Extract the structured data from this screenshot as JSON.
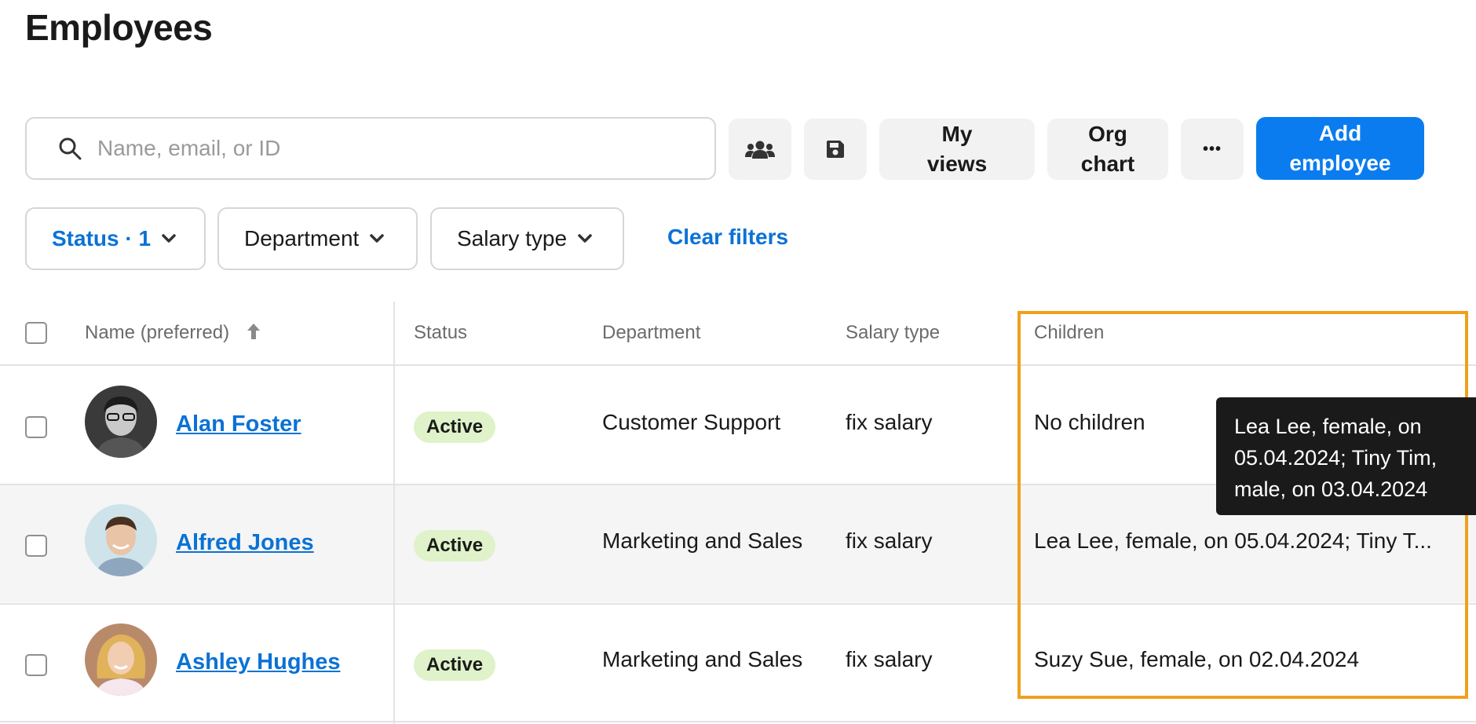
{
  "page": {
    "title": "Employees"
  },
  "search": {
    "placeholder": "Name, email, or ID",
    "icon": "search-icon"
  },
  "toolbar": {
    "groups_icon": "users-icon",
    "save_icon": "floppy-disk-icon",
    "my_views_line1": "My",
    "my_views_line2": "views",
    "org_chart_line1": "Org",
    "org_chart_line2": "chart",
    "more_label": "•••",
    "add_employee_line1": "Add",
    "add_employee_line2": "employee"
  },
  "filters": [
    {
      "label": "Status · 1",
      "active": true
    },
    {
      "label": "Department",
      "active": false
    },
    {
      "label": "Salary type",
      "active": false
    }
  ],
  "clear_filters": "Clear filters",
  "table": {
    "columns": [
      "Name (preferred)",
      "Status",
      "Department",
      "Salary type",
      "Children"
    ],
    "sort_indicator": "arrow-up-icon",
    "rows": [
      {
        "name": "Alan Foster",
        "status": "Active",
        "department": "Customer Support",
        "salary_type": "fix salary",
        "children": "No children"
      },
      {
        "name": "Alfred Jones",
        "status": "Active",
        "department": "Marketing and Sales",
        "salary_type": "fix salary",
        "children": "Lea Lee, female, on 05.04.2024; Tiny T..."
      },
      {
        "name": "Ashley Hughes",
        "status": "Active",
        "department": "Marketing and Sales",
        "salary_type": "fix salary",
        "children": "Suzy Sue, female, on 02.04.2024"
      }
    ]
  },
  "tooltip": {
    "line1": "Lea Lee, female, on",
    "line2": "05.04.2024; Tiny Tim,",
    "line3": "male, on 03.04.2024"
  },
  "colors": {
    "accent": "#0a7cf0",
    "link": "#0a72d6",
    "badge_bg": "#dff2c9",
    "highlight": "#f0a01e",
    "tooltip_bg": "#1a1a1a"
  }
}
